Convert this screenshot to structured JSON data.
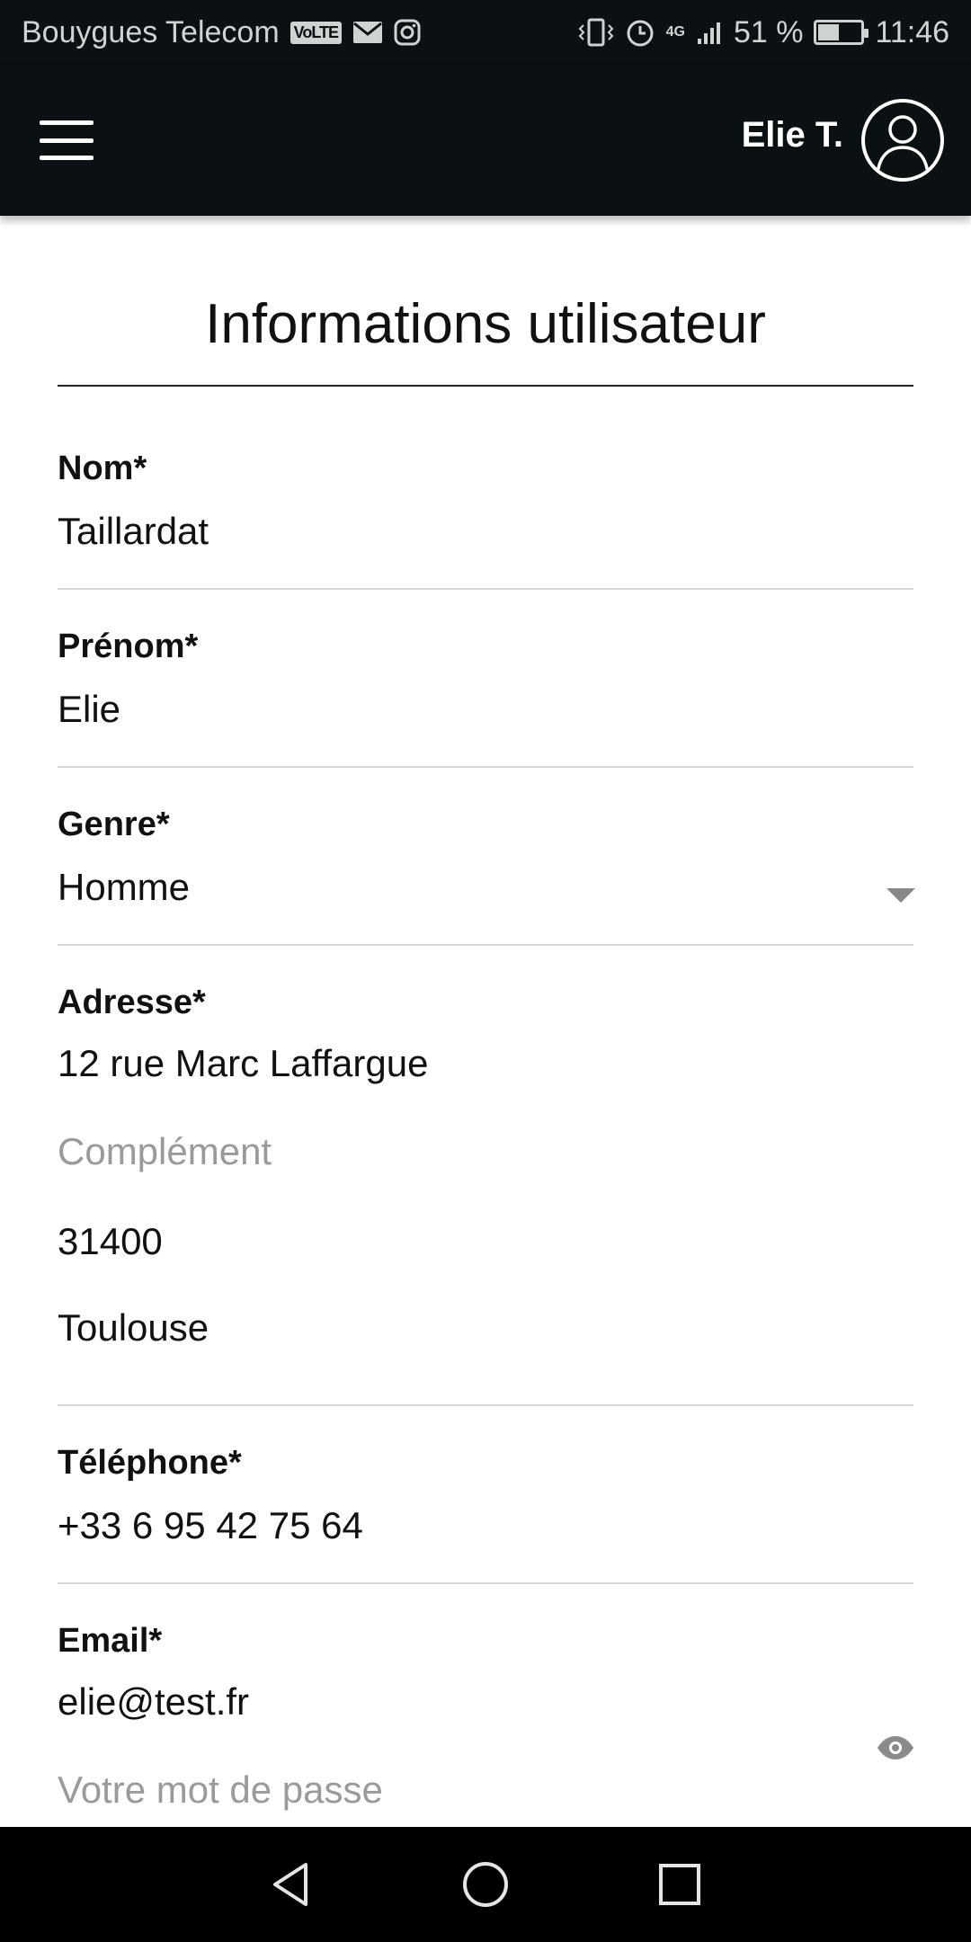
{
  "status_bar": {
    "carrier": "Bouygues Telecom",
    "volte": "VoLTE",
    "battery_percent_text": "51 %",
    "battery_level": 0.51,
    "network": "4G",
    "time": "11:46"
  },
  "header": {
    "user_name": "Elie T."
  },
  "page": {
    "title": "Informations utilisateur"
  },
  "form": {
    "nom": {
      "label": "Nom*",
      "value": "Taillardat"
    },
    "prenom": {
      "label": "Prénom*",
      "value": "Elie"
    },
    "genre": {
      "label": "Genre*",
      "value": "Homme"
    },
    "adresse": {
      "label": "Adresse*",
      "street": "12 rue Marc Laffargue",
      "complement_placeholder": "Complément",
      "postal_code": "31400",
      "city": "Toulouse"
    },
    "telephone": {
      "label": "Téléphone*",
      "value": "+33 6 95 42 75 64"
    },
    "email": {
      "label": "Email*",
      "value": "elie@test.fr"
    },
    "password": {
      "placeholder": "Votre mot de passe"
    }
  },
  "colors": {
    "header_bg": "#0b1012",
    "divider": "#d7d7d7",
    "placeholder": "#9a9a9a"
  }
}
